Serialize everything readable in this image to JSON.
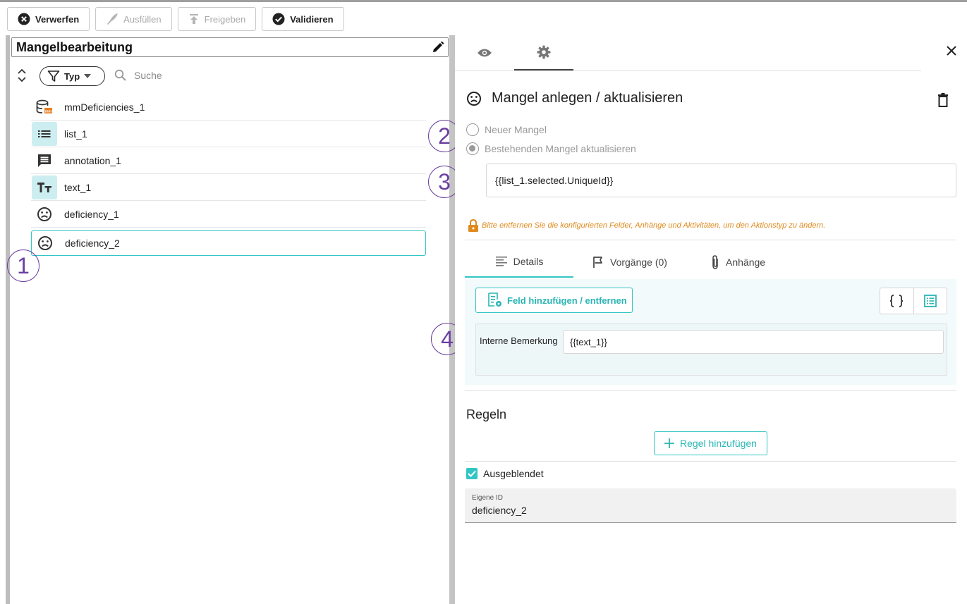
{
  "toolbar": {
    "discard": "Verwerfen",
    "fill": "Ausfüllen",
    "release": "Freigeben",
    "validate": "Validieren"
  },
  "left_panel": {
    "title": "Mangelbearbeitung",
    "filter_chip": "Typ",
    "search_placeholder": "Suche",
    "items": [
      {
        "label": "mmDeficiencies_1",
        "icon": "database-icon"
      },
      {
        "label": "list_1",
        "icon": "list-icon"
      },
      {
        "label": "annotation_1",
        "icon": "comment-icon"
      },
      {
        "label": "text_1",
        "icon": "text-type-icon"
      },
      {
        "label": "deficiency_1",
        "icon": "sad-face-icon"
      },
      {
        "label": "deficiency_2",
        "icon": "sad-face-icon",
        "selected": true
      }
    ]
  },
  "callouts": [
    "1",
    "2",
    "3",
    "4"
  ],
  "right_panel": {
    "title": "Mangel anlegen / aktualisieren",
    "radio_new": "Neuer Mangel",
    "radio_update": "Bestehenden Mangel aktualisieren",
    "id_expression": "{{list_1.selected.UniqueId}}",
    "warning": "Bitte entfernen Sie die konfigurierten Felder, Anhänge und Aktivitäten, um den Aktionstyp zu ändern.",
    "tabs": {
      "details": "Details",
      "processes": "Vorgänge (0)",
      "attachments": "Anhänge"
    },
    "add_field_button": "Feld hinzufügen / entfernen",
    "field_label": "Interne Bemerkung",
    "field_value": "{{text_1}}",
    "rules_heading": "Regeln",
    "add_rule_button": "Regel hinzufügen",
    "hidden_checkbox": "Ausgeblendet",
    "own_id_caption": "Eigene ID",
    "own_id_value": "deficiency_2"
  },
  "colors": {
    "accent": "#33c5c5",
    "callout": "#6b3fa0",
    "warning": "#e08a1e"
  }
}
